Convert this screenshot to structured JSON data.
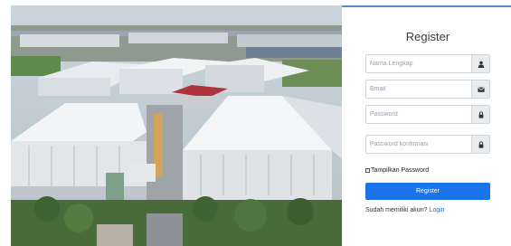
{
  "photo": {
    "subject": "factory-complex-aerial-photo"
  },
  "register": {
    "title": "Register",
    "fields": [
      {
        "name": "name",
        "placeholder": "Nama Lengkap",
        "icon": "user-icon"
      },
      {
        "name": "email",
        "placeholder": "Email",
        "icon": "envelope-icon"
      },
      {
        "name": "password",
        "placeholder": "Password",
        "icon": "lock-icon"
      },
      {
        "name": "password_confirm",
        "placeholder": "Password konfirmasi",
        "icon": "lock-icon"
      }
    ],
    "show_password_label": "Tampilkan Password",
    "submit_label": "Register",
    "have_account_text": "Sudah memiliki akun?",
    "login_link": "Login"
  },
  "colors": {
    "primary": "#1a73e8",
    "top_border": "#5a87c6"
  }
}
